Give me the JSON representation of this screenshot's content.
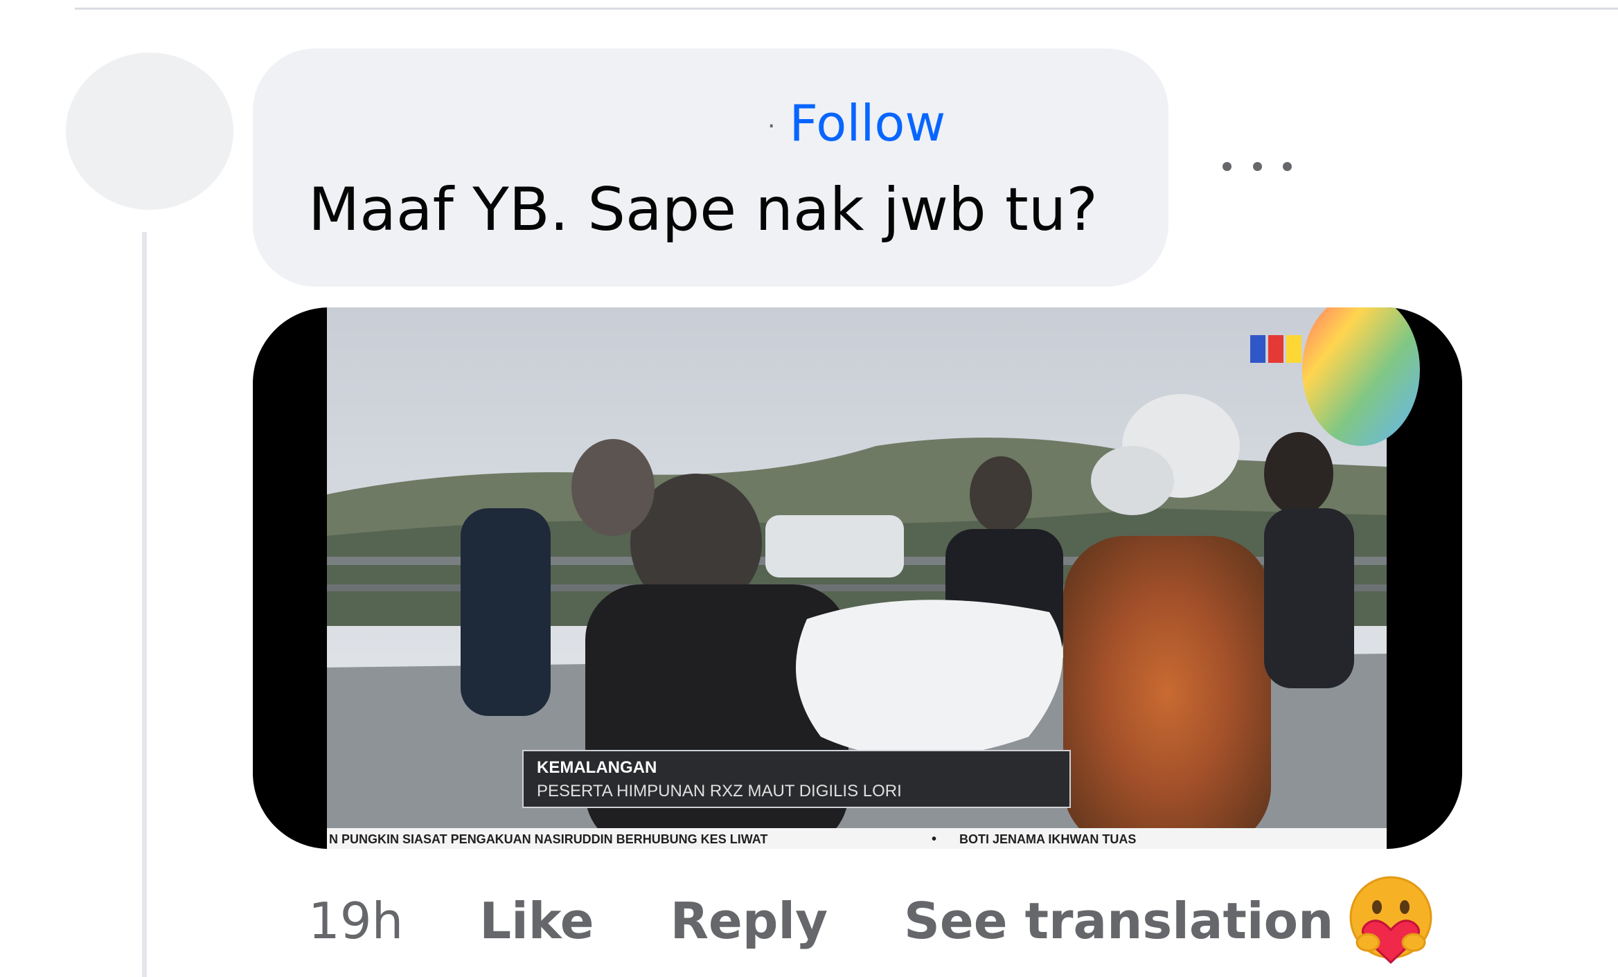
{
  "comment": {
    "separator": "·",
    "follow_label": "Follow",
    "text": "Maaf YB. Sape nak jwb tu?",
    "more_icon": "more-options-icon"
  },
  "media": {
    "type": "news-video-still",
    "channel_logo": "tv3-logo",
    "headline_label": "KEMALANGAN",
    "headline_text": "PESERTA HIMPUNAN RXZ MAUT DIGILIS LORI",
    "ticker_left": "N PUNGKIN SIASAT PENGAKUAN NASIRUDDIN BERHUBUNG KES LIWAT",
    "ticker_bullet": "•",
    "ticker_right": "BOTI JENAMA IKHWAN TUAS"
  },
  "actions": {
    "timestamp": "19h",
    "like_label": "Like",
    "reply_label": "Reply",
    "translate_label": "See translation"
  },
  "reaction": {
    "icon": "care-reaction-icon"
  },
  "colors": {
    "link": "#0866ff",
    "muted": "#65676b",
    "bubble": "#eff1f4",
    "text": "#050505"
  }
}
